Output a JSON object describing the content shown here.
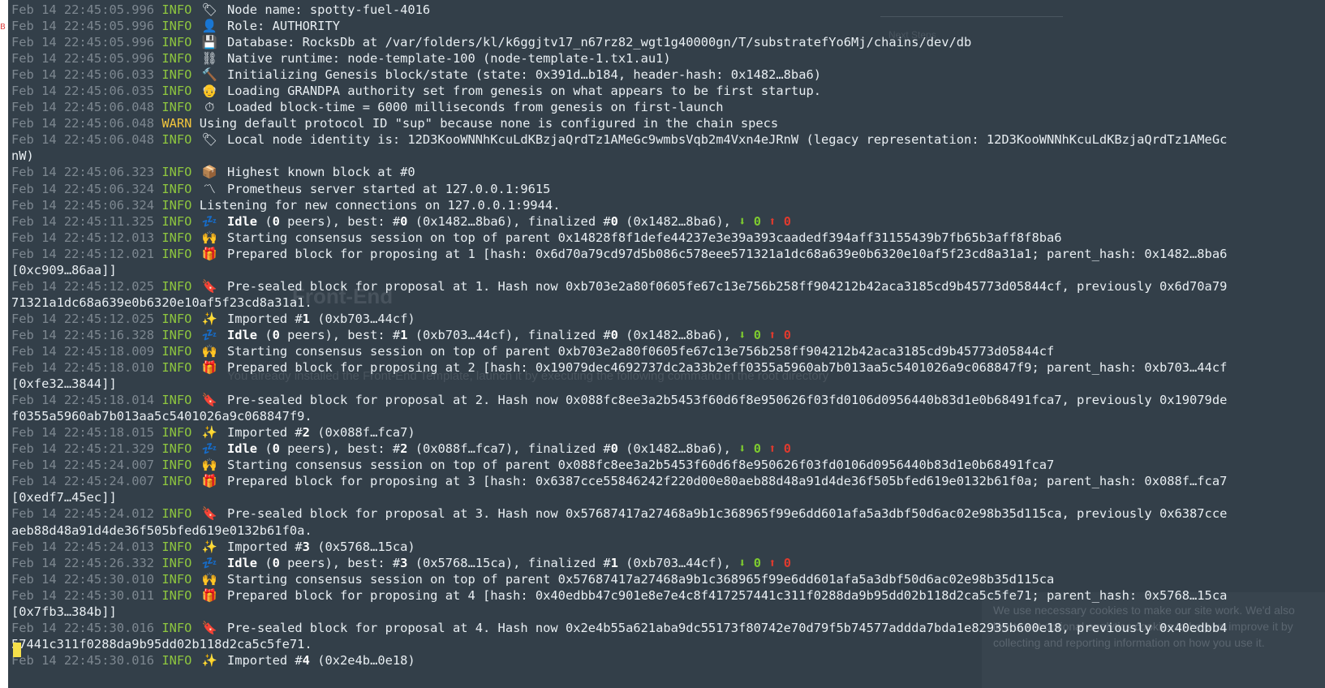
{
  "window": {
    "left_fragment": "B"
  },
  "background_page": {
    "heading": "Front-End",
    "text": "You already installed the Front-End Template, launch it by executing the following command in the root directory",
    "next_steps": "Next Steps",
    "cookie_notice": "We use necessary cookies to make our site work. We'd also like to set optional analytics cookies to help us improve it by collecting and reporting information on how you use it."
  },
  "log_lines": [
    {
      "ts": "Feb 14 22:45:05.996",
      "level": "INFO",
      "icon": "🏷",
      "parts": [
        {
          "t": "Node name: spotty-fuel-4016"
        }
      ]
    },
    {
      "ts": "Feb 14 22:45:05.996",
      "level": "INFO",
      "icon": "👤",
      "parts": [
        {
          "t": "Role: AUTHORITY"
        }
      ]
    },
    {
      "ts": "Feb 14 22:45:05.996",
      "level": "INFO",
      "icon": "💾",
      "parts": [
        {
          "t": "Database: RocksDb at /var/folders/kl/k6ggjtv17_n67rz82_wgt1g40000gn/T/substratefYo6Mj/chains/dev/db"
        }
      ]
    },
    {
      "ts": "Feb 14 22:45:05.996",
      "level": "INFO",
      "icon": "⛓",
      "parts": [
        {
          "t": "Native runtime: node-template-100 (node-template-1.tx1.au1)"
        }
      ]
    },
    {
      "ts": "Feb 14 22:45:06.033",
      "level": "INFO",
      "icon": "🔨",
      "parts": [
        {
          "t": "Initializing Genesis block/state (state: 0x391d…b184, header-hash: 0x1482…8ba6)"
        }
      ]
    },
    {
      "ts": "Feb 14 22:45:06.035",
      "level": "INFO",
      "icon": "👴",
      "parts": [
        {
          "t": "Loading GRANDPA authority set from genesis on what appears to be first startup."
        }
      ]
    },
    {
      "ts": "Feb 14 22:45:06.048",
      "level": "INFO",
      "icon": "⏱",
      "parts": [
        {
          "t": "Loaded block-time = 6000 milliseconds from genesis on first-launch"
        }
      ]
    },
    {
      "ts": "Feb 14 22:45:06.048",
      "level": "WARN",
      "icon": "",
      "parts": [
        {
          "t": "Using default protocol ID \"sup\" because none is configured in the chain specs"
        }
      ]
    },
    {
      "ts": "Feb 14 22:45:06.048",
      "level": "INFO",
      "icon": "🏷",
      "parts": [
        {
          "t": "Local node identity is: 12D3KooWNNhKcuLdKBzjaQrdTz1AMeGc9wmbsVqb2m4Vxn4eJRnW (legacy representation: 12D3KooWNNhKcuLdKBzjaQrdTz1AMeGc"
        }
      ]
    },
    {
      "cont": "nW)"
    },
    {
      "ts": "Feb 14 22:45:06.323",
      "level": "INFO",
      "icon": "📦",
      "parts": [
        {
          "t": "Highest known block at #0"
        }
      ]
    },
    {
      "ts": "Feb 14 22:45:06.324",
      "level": "INFO",
      "icon": "〽",
      "parts": [
        {
          "t": "Prometheus server started at 127.0.0.1:9615"
        }
      ]
    },
    {
      "ts": "Feb 14 22:45:06.324",
      "level": "INFO",
      "icon": "",
      "parts": [
        {
          "t": "Listening for new connections on 127.0.0.1:9944."
        }
      ]
    },
    {
      "ts": "Feb 14 22:45:11.325",
      "level": "INFO",
      "icon": "💤",
      "parts": [
        {
          "t": "Idle",
          "c": "b"
        },
        {
          "t": " ("
        },
        {
          "t": "0",
          "c": "b"
        },
        {
          "t": " peers), best: #"
        },
        {
          "t": "0",
          "c": "b"
        },
        {
          "t": " (0x1482…8ba6), finalized #"
        },
        {
          "t": "0",
          "c": "b"
        },
        {
          "t": " (0x1482…8ba6), "
        },
        {
          "t": "⬇ 0",
          "c": "down"
        },
        {
          "t": " "
        },
        {
          "t": "⬆ 0",
          "c": "up"
        }
      ]
    },
    {
      "ts": "Feb 14 22:45:12.013",
      "level": "INFO",
      "icon": "🙌",
      "parts": [
        {
          "t": "Starting consensus session on top of parent 0x14828f8f1defe44237e3e39a393caadedf394aff31155439b7fb65b3aff8f8ba6"
        }
      ]
    },
    {
      "ts": "Feb 14 22:45:12.021",
      "level": "INFO",
      "icon": "🎁",
      "parts": [
        {
          "t": "Prepared block for proposing at 1 [hash: 0x6d70a79cd97d5b086c578eee571321a1dc68a639e0b6320e10af5f23cd8a31a1; parent_hash: 0x1482…8ba6"
        }
      ]
    },
    {
      "cont": "[0xc909…86aa]]"
    },
    {
      "ts": "Feb 14 22:45:12.025",
      "level": "INFO",
      "icon": "🔖",
      "parts": [
        {
          "t": "Pre-sealed block for proposal at 1. Hash now 0xb703e2a80f0605fe67c13e756b258ff904212b42aca3185cd9b45773d05844cf, previously 0x6d70a79"
        }
      ]
    },
    {
      "cont": "71321a1dc68a639e0b6320e10af5f23cd8a31a1."
    },
    {
      "ts": "Feb 14 22:45:12.025",
      "level": "INFO",
      "icon": "✨",
      "parts": [
        {
          "t": "Imported #"
        },
        {
          "t": "1",
          "c": "b"
        },
        {
          "t": " (0xb703…44cf)"
        }
      ]
    },
    {
      "ts": "Feb 14 22:45:16.328",
      "level": "INFO",
      "icon": "💤",
      "parts": [
        {
          "t": "Idle",
          "c": "b"
        },
        {
          "t": " ("
        },
        {
          "t": "0",
          "c": "b"
        },
        {
          "t": " peers), best: #"
        },
        {
          "t": "1",
          "c": "b"
        },
        {
          "t": " (0xb703…44cf), finalized #"
        },
        {
          "t": "0",
          "c": "b"
        },
        {
          "t": " (0x1482…8ba6), "
        },
        {
          "t": "⬇ 0",
          "c": "down"
        },
        {
          "t": " "
        },
        {
          "t": "⬆ 0",
          "c": "up"
        }
      ]
    },
    {
      "ts": "Feb 14 22:45:18.009",
      "level": "INFO",
      "icon": "🙌",
      "parts": [
        {
          "t": "Starting consensus session on top of parent 0xb703e2a80f0605fe67c13e756b258ff904212b42aca3185cd9b45773d05844cf"
        }
      ]
    },
    {
      "ts": "Feb 14 22:45:18.010",
      "level": "INFO",
      "icon": "🎁",
      "parts": [
        {
          "t": "Prepared block for proposing at 2 [hash: 0x19079dec4692737dc2a33b2eff0355a5960ab7b013aa5c5401026a9c068847f9; parent_hash: 0xb703…44cf"
        }
      ]
    },
    {
      "cont": "[0xfe32…3844]]"
    },
    {
      "ts": "Feb 14 22:45:18.014",
      "level": "INFO",
      "icon": "🔖",
      "parts": [
        {
          "t": "Pre-sealed block for proposal at 2. Hash now 0x088fc8ee3a2b5453f60d6f8e950626f03fd0106d0956440b83d1e0b68491fca7, previously 0x19079de"
        }
      ]
    },
    {
      "cont": "f0355a5960ab7b013aa5c5401026a9c068847f9."
    },
    {
      "ts": "Feb 14 22:45:18.015",
      "level": "INFO",
      "icon": "✨",
      "parts": [
        {
          "t": "Imported #"
        },
        {
          "t": "2",
          "c": "b"
        },
        {
          "t": " (0x088f…fca7)"
        }
      ]
    },
    {
      "ts": "Feb 14 22:45:21.329",
      "level": "INFO",
      "icon": "💤",
      "parts": [
        {
          "t": "Idle",
          "c": "b"
        },
        {
          "t": " ("
        },
        {
          "t": "0",
          "c": "b"
        },
        {
          "t": " peers), best: #"
        },
        {
          "t": "2",
          "c": "b"
        },
        {
          "t": " (0x088f…fca7), finalized #"
        },
        {
          "t": "0",
          "c": "b"
        },
        {
          "t": " (0x1482…8ba6), "
        },
        {
          "t": "⬇ 0",
          "c": "down"
        },
        {
          "t": " "
        },
        {
          "t": "⬆ 0",
          "c": "up"
        }
      ]
    },
    {
      "ts": "Feb 14 22:45:24.007",
      "level": "INFO",
      "icon": "🙌",
      "parts": [
        {
          "t": "Starting consensus session on top of parent 0x088fc8ee3a2b5453f60d6f8e950626f03fd0106d0956440b83d1e0b68491fca7"
        }
      ]
    },
    {
      "ts": "Feb 14 22:45:24.007",
      "level": "INFO",
      "icon": "🎁",
      "parts": [
        {
          "t": "Prepared block for proposing at 3 [hash: 0x6387cce55846242f220d00e80aeb88d48a91d4de36f505bfed619e0132b61f0a; parent_hash: 0x088f…fca7"
        }
      ]
    },
    {
      "cont": "[0xedf7…45ec]]"
    },
    {
      "ts": "Feb 14 22:45:24.012",
      "level": "INFO",
      "icon": "🔖",
      "parts": [
        {
          "t": "Pre-sealed block for proposal at 3. Hash now 0x57687417a27468a9b1c368965f99e6dd601afa5a3dbf50d6ac02e98b35d115ca, previously 0x6387cce"
        }
      ]
    },
    {
      "cont": "aeb88d48a91d4de36f505bfed619e0132b61f0a."
    },
    {
      "ts": "Feb 14 22:45:24.013",
      "level": "INFO",
      "icon": "✨",
      "parts": [
        {
          "t": "Imported #"
        },
        {
          "t": "3",
          "c": "b"
        },
        {
          "t": " (0x5768…15ca)"
        }
      ]
    },
    {
      "ts": "Feb 14 22:45:26.332",
      "level": "INFO",
      "icon": "💤",
      "parts": [
        {
          "t": "Idle",
          "c": "b"
        },
        {
          "t": " ("
        },
        {
          "t": "0",
          "c": "b"
        },
        {
          "t": " peers), best: #"
        },
        {
          "t": "3",
          "c": "b"
        },
        {
          "t": " (0x5768…15ca), finalized #"
        },
        {
          "t": "1",
          "c": "b"
        },
        {
          "t": " (0xb703…44cf), "
        },
        {
          "t": "⬇ 0",
          "c": "down"
        },
        {
          "t": " "
        },
        {
          "t": "⬆ 0",
          "c": "up"
        }
      ]
    },
    {
      "ts": "Feb 14 22:45:30.010",
      "level": "INFO",
      "icon": "🙌",
      "parts": [
        {
          "t": "Starting consensus session on top of parent 0x57687417a27468a9b1c368965f99e6dd601afa5a3dbf50d6ac02e98b35d115ca"
        }
      ]
    },
    {
      "ts": "Feb 14 22:45:30.011",
      "level": "INFO",
      "icon": "🎁",
      "parts": [
        {
          "t": "Prepared block for proposing at 4 [hash: 0x40edbb47c901e8e7e4c8f417257441c311f0288da9b95dd02b118d2ca5c5fe71; parent_hash: 0x5768…15ca"
        }
      ]
    },
    {
      "cont": "[0x7fb3…384b]]"
    },
    {
      "ts": "Feb 14 22:45:30.016",
      "level": "INFO",
      "icon": "🔖",
      "parts": [
        {
          "t": "Pre-sealed block for proposal at 4. Hash now 0x2e4b55a621aba9dc55173f80742e70d79f5b74577addda7bda1e82935b600e18, previously 0x40edbb4"
        }
      ]
    },
    {
      "cont": "57441c311f0288da9b95dd02b118d2ca5c5fe71."
    },
    {
      "ts": "Feb 14 22:45:30.016",
      "level": "INFO",
      "icon": "✨",
      "parts": [
        {
          "t": "Imported #"
        },
        {
          "t": "4",
          "c": "b"
        },
        {
          "t": " (0x2e4b…0e18)"
        }
      ]
    }
  ],
  "colors": {
    "terminal_bg": "#2b3742",
    "timestamp": "#7d8790",
    "info": "#8ec63f",
    "warn": "#f2c53d",
    "cursor": "#f6e04a"
  }
}
